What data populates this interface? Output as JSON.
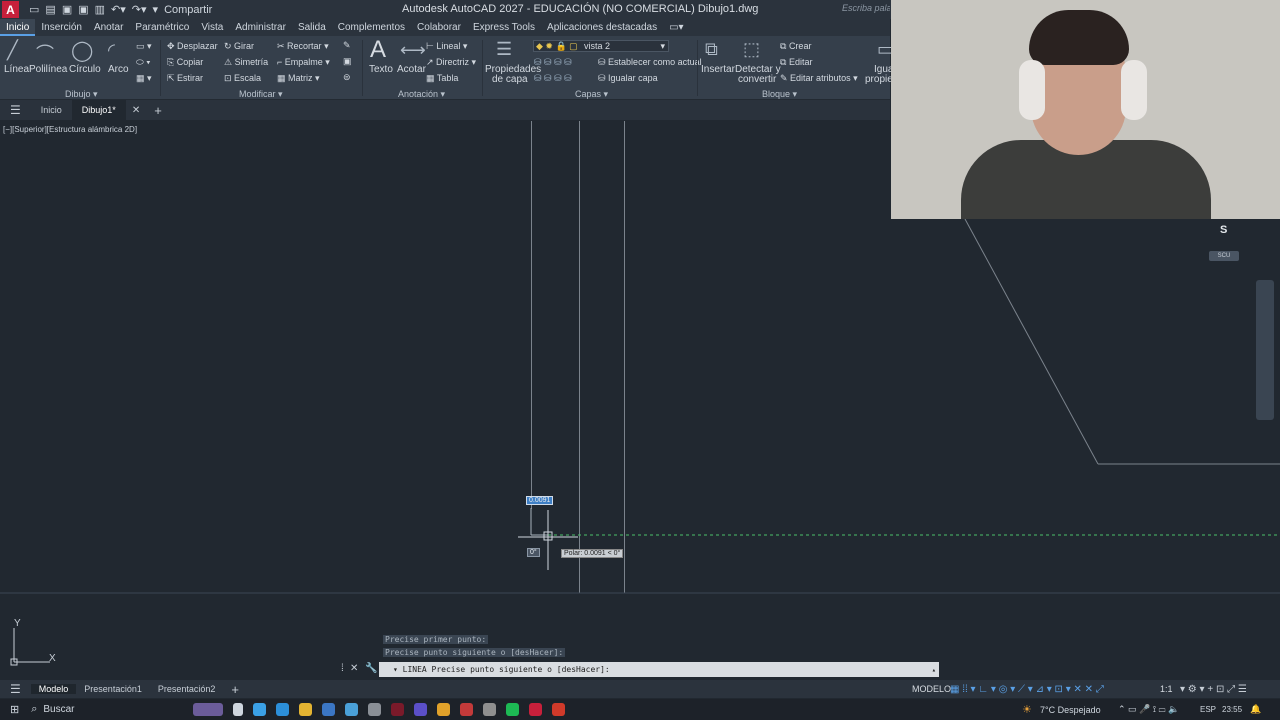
{
  "titlebar": {
    "logo": "A",
    "share_label": "Compartir",
    "window_title": "Autodesk AutoCAD 2027 - EDUCACIÓN (NO COMERCIAL)     Dibujo1.dwg",
    "search_placeholder": "Escriba palabra"
  },
  "menu": {
    "items": [
      "Inicio",
      "Inserción",
      "Anotar",
      "Paramétrico",
      "Vista",
      "Administrar",
      "Salida",
      "Complementos",
      "Colaborar",
      "Express Tools",
      "Aplicaciones destacadas"
    ]
  },
  "ribbon": {
    "draw": {
      "linea": "Línea",
      "polilinea": "Polilínea",
      "circulo": "Círculo",
      "arco": "Arco",
      "panel": "Dibujo"
    },
    "modify": {
      "desplazar": "Desplazar",
      "girar": "Girar",
      "recortar": "Recortar",
      "copiar": "Copiar",
      "simetria": "Simetría",
      "empalme": "Empalme",
      "estirar": "Estirar",
      "escala": "Escala",
      "matriz": "Matriz",
      "panel": "Modificar"
    },
    "annotation": {
      "texto": "Texto",
      "acotar": "Acotar",
      "lineal": "Lineal",
      "directriz": "Directriz",
      "tabla": "Tabla",
      "panel": "Anotación"
    },
    "layers": {
      "propiedades1": "Propiedades",
      "propiedades2": "de capa",
      "layer_name": "vista 2",
      "establecer": "Establecer como actual",
      "igualar": "Igualar capa",
      "panel": "Capas"
    },
    "block": {
      "insertar": "Insertar",
      "detectar1": "Detectar y",
      "detectar2": "convertir",
      "crear": "Crear",
      "editar": "Editar",
      "editar_atributos": "Editar atributos",
      "panel": "Bloque"
    },
    "extra": {
      "igua1": "Igua",
      "igua2": "propie"
    }
  },
  "tabs": {
    "inicio": "Inicio",
    "dibujo": "Dibujo1*"
  },
  "viewport": {
    "label": "[−][Superior][Estructura alámbrica 2D]",
    "dyn_input": "0.0091",
    "angle": "0°",
    "polar_tooltip": "Polar: 0.0091 < 0°",
    "viewcube_letter": "S",
    "wcs_label": "SCU"
  },
  "ucs": {
    "x": "X",
    "y": "Y"
  },
  "command": {
    "history1": "Precise primer punto:",
    "history2": "Precise punto siguiente o [desHacer]:",
    "current": "▾ LINEA Precise punto siguiente o [desHacer]:"
  },
  "status": {
    "layouts": [
      "Modelo",
      "Presentación1",
      "Presentación2"
    ],
    "modelo": "MODELO",
    "scale": "1:1"
  },
  "taskbar": {
    "search": "Buscar",
    "weather": "7°C  Despejado",
    "lang": "ESP",
    "time": "23:55"
  }
}
